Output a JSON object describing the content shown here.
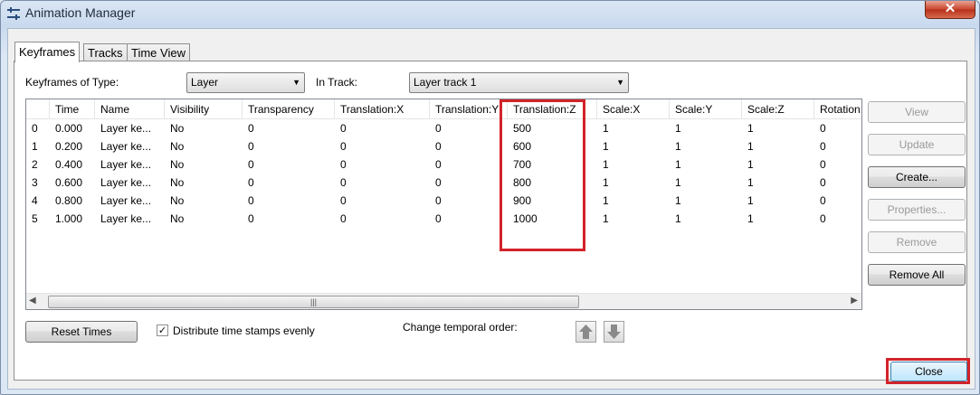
{
  "window": {
    "title": "Animation Manager",
    "close_glyph": "✕"
  },
  "tabs": [
    {
      "label": "Keyframes",
      "active": true
    },
    {
      "label": "Tracks",
      "active": false
    },
    {
      "label": "Time View",
      "active": false
    }
  ],
  "filters": {
    "type_label": "Keyframes of Type:",
    "type_value": "Layer",
    "track_label": "In Track:",
    "track_value": "Layer track 1"
  },
  "table": {
    "headers": [
      "",
      "Time",
      "Name",
      "Visibility",
      "Transparency",
      "Translation:X",
      "Translation:Y",
      "Translation:Z",
      "Scale:X",
      "Scale:Y",
      "Scale:Z",
      "Rotation:"
    ],
    "rows": [
      [
        "0",
        "0.000",
        "Layer ke...",
        "No",
        "0",
        "0",
        "0",
        "500",
        "1",
        "1",
        "1",
        "0"
      ],
      [
        "1",
        "0.200",
        "Layer ke...",
        "No",
        "0",
        "0",
        "0",
        "600",
        "1",
        "1",
        "1",
        "0"
      ],
      [
        "2",
        "0.400",
        "Layer ke...",
        "No",
        "0",
        "0",
        "0",
        "700",
        "1",
        "1",
        "1",
        "0"
      ],
      [
        "3",
        "0.600",
        "Layer ke...",
        "No",
        "0",
        "0",
        "0",
        "800",
        "1",
        "1",
        "1",
        "0"
      ],
      [
        "4",
        "0.800",
        "Layer ke...",
        "No",
        "0",
        "0",
        "0",
        "900",
        "1",
        "1",
        "1",
        "0"
      ],
      [
        "5",
        "1.000",
        "Layer ke...",
        "No",
        "0",
        "0",
        "0",
        "1000",
        "1",
        "1",
        "1",
        "0"
      ]
    ],
    "scroll_left": "◀",
    "scroll_right": "▶",
    "scroll_thumb": "|||"
  },
  "side_buttons": [
    {
      "label": "View",
      "enabled": false
    },
    {
      "label": "Update",
      "enabled": false
    },
    {
      "label": "Create...",
      "enabled": true
    },
    {
      "label": "Properties...",
      "enabled": false
    },
    {
      "label": "Remove",
      "enabled": false
    },
    {
      "label": "Remove All",
      "enabled": true
    }
  ],
  "bottom": {
    "reset_label": "Reset Times",
    "distribute_label": "Distribute time stamps evenly",
    "distribute_checked": "✓",
    "order_label": "Change temporal order:"
  },
  "footer": {
    "close_label": "Close"
  },
  "colors": {
    "highlight": "#d2232a",
    "arrow": "#8a8a8a"
  },
  "icons": {
    "app": "keyframe-app-icon",
    "up": "arrow-up-icon",
    "down": "arrow-down-icon"
  }
}
